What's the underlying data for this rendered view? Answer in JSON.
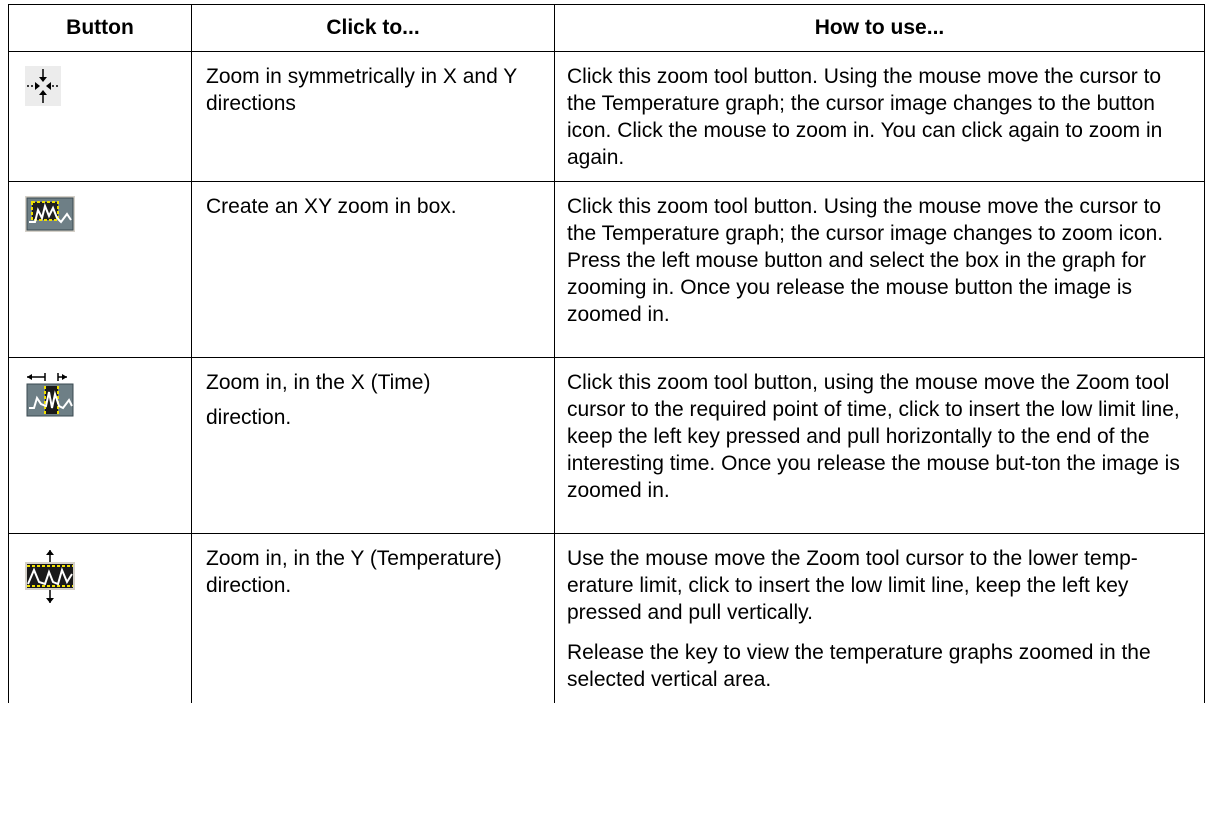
{
  "table": {
    "headers": [
      "Button",
      "Click to...",
      "How to use..."
    ],
    "rows": [
      {
        "icon": "zoom-symmetric-icon",
        "click_to": [
          "Zoom in symmetrically in X and Y directions"
        ],
        "how_to_use": [
          "Click this zoom tool button. Using the mouse move the cursor to the Temperature graph; the cursor image changes to the button icon. Click the mouse to zoom in. You can click again to zoom in again."
        ]
      },
      {
        "icon": "zoom-box-icon",
        "click_to": [
          "Create an XY zoom in box."
        ],
        "how_to_use": [
          "Click this zoom tool button. Using the mouse move the cursor to the Temperature graph; the cursor image changes to zoom icon. Press the left mouse button and select the box in the graph for zooming in. Once you release the mouse button the image is zoomed in."
        ]
      },
      {
        "icon": "zoom-x-icon",
        "click_to": [
          "Zoom in, in the X (Time)",
          "direction."
        ],
        "how_to_use": [
          "Click this zoom tool button, using the mouse move the Zoom tool cursor to the required point of time, click to insert the low limit line, keep the left key pressed and pull horizontally to the end of the interesting time. Once you release the mouse but-ton the image is zoomed in."
        ]
      },
      {
        "icon": "zoom-y-icon",
        "click_to": [
          "Zoom in, in the Y (Temperature) direction."
        ],
        "how_to_use": [
          "Use the mouse move the Zoom tool cursor to the lower temp-erature limit, click to insert the low limit line, keep the left key pressed and pull vertically.",
          "Release the key to view the temperature graphs zoomed in the selected vertical area."
        ]
      }
    ]
  }
}
